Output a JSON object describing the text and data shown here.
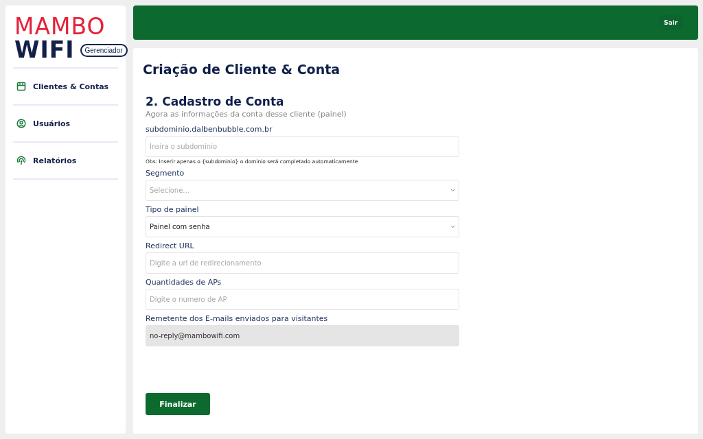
{
  "logo": {
    "brand_top": "MAMBO",
    "brand_bottom": "WIFI",
    "badge": "Gerenciador"
  },
  "sidebar": {
    "items": [
      {
        "label": "Clientes & Contas"
      },
      {
        "label": "Usuários"
      },
      {
        "label": "Relatórios"
      }
    ]
  },
  "topbar": {
    "logout": "Sair"
  },
  "page": {
    "title": "Criação de Cliente & Conta",
    "section_title": "2. Cadastro de Conta",
    "section_subtitle": "Agora as informações da conta desse cliente (painel)",
    "fields": [
      {
        "kind": "input",
        "label": "subdominio.dalbenbubble.com.br",
        "placeholder": "Insira o subdominio",
        "hint": "Obs: Inserir apenas o {subdominio} o dominio será completado automaticamente"
      },
      {
        "kind": "select",
        "label": "Segmento",
        "placeholder": "Selecione..."
      },
      {
        "kind": "select",
        "label": "Tipo de painel",
        "value": "Painel com senha"
      },
      {
        "kind": "input",
        "label": "Redirect URL",
        "placeholder": "Digite a url de redirecionamento"
      },
      {
        "kind": "input",
        "label": "Quantidades de APs",
        "placeholder": "Digite o numero de AP"
      },
      {
        "kind": "readonly",
        "label": "Remetente dos E-mails enviados para visitantes",
        "value": "no-reply@mambowifi.com"
      }
    ],
    "submit": "Finalizar"
  }
}
